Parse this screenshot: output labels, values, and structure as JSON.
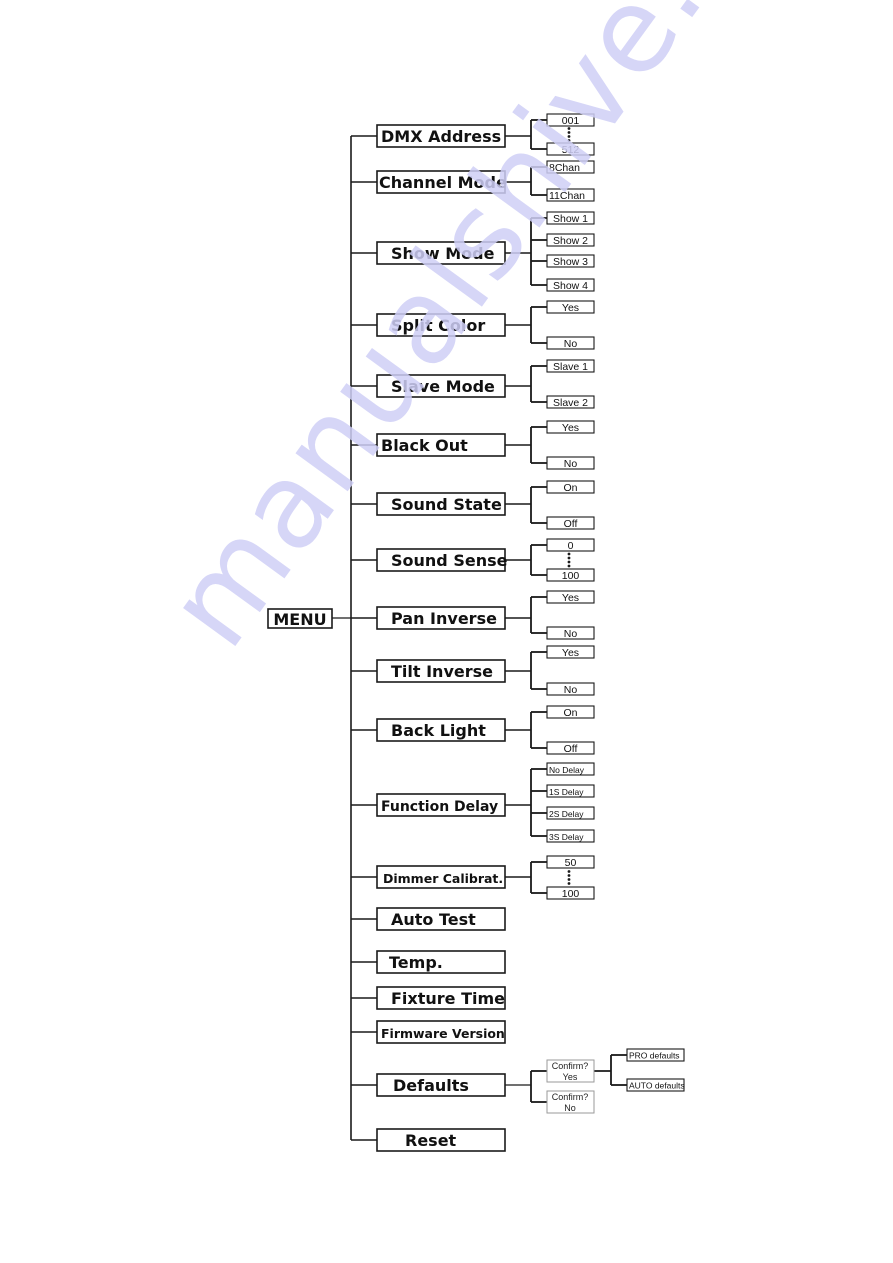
{
  "root": {
    "label": "MENU"
  },
  "watermark": "manualshive.com",
  "colors": {
    "line": "#1a1a1a",
    "watermark": "#cfcff6",
    "confirm_border": "#9a9a9a"
  },
  "menu_items": [
    {
      "id": "dmx-address",
      "label": "DMX Address",
      "options": [
        "001",
        "512"
      ],
      "range": true
    },
    {
      "id": "channel-mode",
      "label": "Channel Mode",
      "options": [
        "8Chan",
        "11Chan"
      ]
    },
    {
      "id": "show-mode",
      "label": "Show Mode",
      "options": [
        "Show 1",
        "Show 2",
        "Show 3",
        "Show 4"
      ]
    },
    {
      "id": "split-color",
      "label": "Split Color",
      "options": [
        "Yes",
        "No"
      ]
    },
    {
      "id": "slave-mode",
      "label": "Slave Mode",
      "options": [
        "Slave 1",
        "Slave 2"
      ]
    },
    {
      "id": "black-out",
      "label": "Black Out",
      "options": [
        "Yes",
        "No"
      ]
    },
    {
      "id": "sound-state",
      "label": "Sound State",
      "options": [
        "On",
        "Off"
      ]
    },
    {
      "id": "sound-sense",
      "label": "Sound Sense",
      "options": [
        "0",
        "100"
      ],
      "range": true
    },
    {
      "id": "pan-inverse",
      "label": "Pan Inverse",
      "options": [
        "Yes",
        "No"
      ]
    },
    {
      "id": "tilt-inverse",
      "label": "Tilt Inverse",
      "options": [
        "Yes",
        "No"
      ]
    },
    {
      "id": "back-light",
      "label": "Back Light",
      "options": [
        "On",
        "Off"
      ]
    },
    {
      "id": "function-delay",
      "label": "Function Delay",
      "options": [
        "No Delay",
        "1S Delay",
        "2S Delay",
        "3S Delay"
      ]
    },
    {
      "id": "dimmer-calibrat",
      "label": "Dimmer Calibrat.",
      "options": [
        "50",
        "100"
      ],
      "range": true
    },
    {
      "id": "auto-test",
      "label": "Auto Test",
      "options": []
    },
    {
      "id": "temp",
      "label": "Temp.",
      "options": []
    },
    {
      "id": "fixture-time",
      "label": "Fixture Time",
      "options": []
    },
    {
      "id": "firmware-version",
      "label": "Firmware Version",
      "options": []
    },
    {
      "id": "defaults",
      "label": "Defaults",
      "options": [],
      "confirm": [
        {
          "line1": "Confirm?",
          "line2": "Yes",
          "children": [
            "PRO defaults",
            "AUTO defaults"
          ]
        },
        {
          "line1": "Confirm?",
          "line2": "No",
          "children": []
        }
      ]
    },
    {
      "id": "reset",
      "label": "Reset",
      "options": []
    }
  ]
}
